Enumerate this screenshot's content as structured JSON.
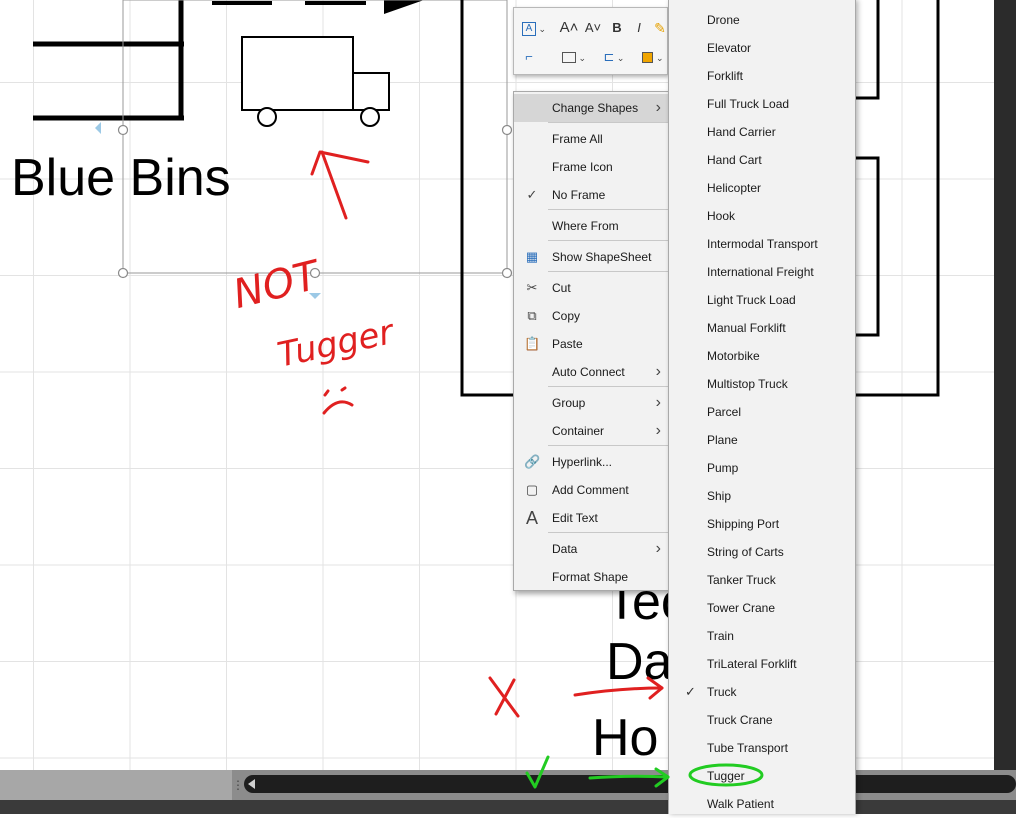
{
  "canvas": {
    "blue_bins_label": "Blue Bins",
    "partial_labels": [
      "Tec",
      "Da",
      "Ho"
    ]
  },
  "annotations": {
    "not_text": "NOT",
    "tugger_text": "Tugger",
    "x_mark": "X",
    "check_mark": "✓",
    "red_color": "#e02020",
    "green_color": "#22cc22"
  },
  "mini_toolbar": {
    "row1": [
      "text-box-icon",
      "increase-font-icon",
      "decrease-font-icon",
      "bold-icon",
      "italic-icon",
      "format-painter-icon"
    ],
    "row2": [
      "connector-icon",
      "align-icon",
      "position-icon",
      "arrange-icon"
    ],
    "labels": {
      "increase_font": "A˄",
      "decrease_font": "A˅",
      "bold": "B",
      "italic": "I"
    }
  },
  "context_menu": {
    "items": [
      {
        "label": "Change Shapes",
        "submenu": true,
        "icon": ""
      },
      {
        "label": "Frame All",
        "submenu": false,
        "icon": ""
      },
      {
        "label": "Frame Icon",
        "submenu": false,
        "icon": ""
      },
      {
        "label": "No Frame",
        "submenu": false,
        "icon": "check"
      },
      {
        "label": "Where From",
        "submenu": false,
        "icon": ""
      },
      {
        "label": "Show ShapeSheet",
        "submenu": false,
        "icon": "grid"
      },
      {
        "label": "Cut",
        "submenu": false,
        "icon": "scissors"
      },
      {
        "label": "Copy",
        "submenu": false,
        "icon": "copy"
      },
      {
        "label": "Paste",
        "submenu": false,
        "icon": "clipboard"
      },
      {
        "label": "Auto Connect",
        "submenu": true,
        "icon": ""
      },
      {
        "label": "Group",
        "submenu": true,
        "icon": ""
      },
      {
        "label": "Container",
        "submenu": true,
        "icon": ""
      },
      {
        "label": "Hyperlink...",
        "submenu": false,
        "icon": "link"
      },
      {
        "label": "Add Comment",
        "submenu": false,
        "icon": "comment"
      },
      {
        "label": "Edit Text",
        "submenu": false,
        "icon": "text"
      },
      {
        "label": "Data",
        "submenu": true,
        "icon": ""
      },
      {
        "label": "Format Shape",
        "submenu": false,
        "icon": ""
      }
    ]
  },
  "change_shapes_submenu": {
    "items": [
      {
        "label": "Drone",
        "checked": false
      },
      {
        "label": "Elevator",
        "checked": false
      },
      {
        "label": "Forklift",
        "checked": false
      },
      {
        "label": "Full Truck Load",
        "checked": false
      },
      {
        "label": "Hand Carrier",
        "checked": false
      },
      {
        "label": "Hand Cart",
        "checked": false
      },
      {
        "label": "Helicopter",
        "checked": false
      },
      {
        "label": "Hook",
        "checked": false
      },
      {
        "label": "Intermodal Transport",
        "checked": false
      },
      {
        "label": "International Freight",
        "checked": false
      },
      {
        "label": "Light Truck Load",
        "checked": false
      },
      {
        "label": "Manual Forklift",
        "checked": false
      },
      {
        "label": "Motorbike",
        "checked": false
      },
      {
        "label": "Multistop Truck",
        "checked": false
      },
      {
        "label": "Parcel",
        "checked": false
      },
      {
        "label": "Plane",
        "checked": false
      },
      {
        "label": "Pump",
        "checked": false
      },
      {
        "label": "Ship",
        "checked": false
      },
      {
        "label": "Shipping Port",
        "checked": false
      },
      {
        "label": "String of Carts",
        "checked": false
      },
      {
        "label": "Tanker Truck",
        "checked": false
      },
      {
        "label": "Tower Crane",
        "checked": false
      },
      {
        "label": "Train",
        "checked": false
      },
      {
        "label": "TriLateral Forklift",
        "checked": false
      },
      {
        "label": "Truck",
        "checked": true
      },
      {
        "label": "Truck Crane",
        "checked": false
      },
      {
        "label": "Tube Transport",
        "checked": false
      },
      {
        "label": "Tugger",
        "checked": false
      },
      {
        "label": "Walk Patient",
        "checked": false
      }
    ]
  }
}
